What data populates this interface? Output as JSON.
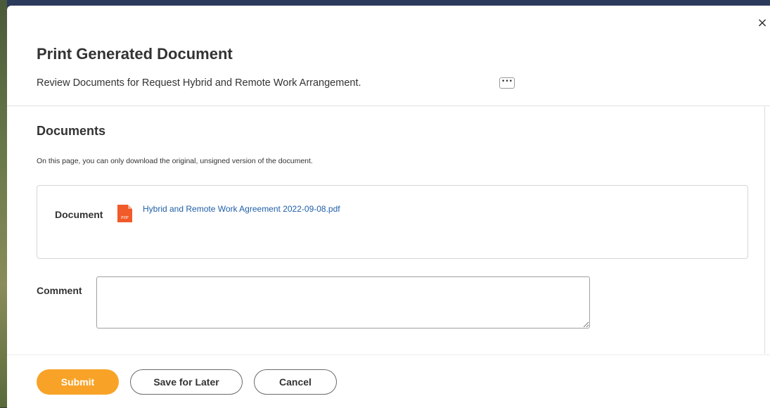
{
  "dialog": {
    "title": "Print Generated Document",
    "subtitle": "Review Documents for Request Hybrid and Remote Work Arrangement.",
    "related_actions_label": "•••",
    "close_label": "×"
  },
  "documents": {
    "section_title": "Documents",
    "notice": "On this page, you can only download the original, unsigned version of the document.",
    "field_label": "Document",
    "file_icon_text": "PDF",
    "file_name": "Hybrid and Remote Work Agreement 2022-09-08.pdf"
  },
  "comment": {
    "label": "Comment",
    "value": ""
  },
  "footer": {
    "submit_label": "Submit",
    "save_label": "Save for Later",
    "cancel_label": "Cancel"
  },
  "colors": {
    "primary_button": "#f8a327",
    "link": "#1f5fa8",
    "pdf_icon": "#f15a29"
  },
  "icons": {
    "close": "close-icon",
    "related_actions": "ellipsis-icon",
    "file": "pdf-file-icon"
  }
}
